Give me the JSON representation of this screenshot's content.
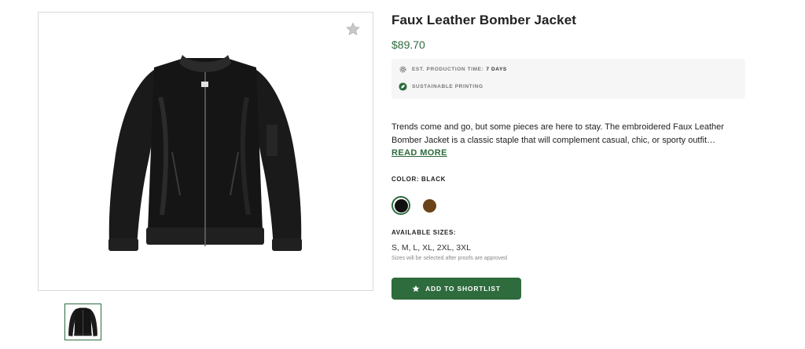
{
  "product": {
    "title": "Faux Leather Bomber Jacket",
    "price": "$89.70",
    "description": "Trends come and go, but some pieces are here to stay. The embroidered Faux Leather Bomber Jacket is a classic staple that will complement casual, chic, or sporty outfit…",
    "read_more_label": "READ MORE"
  },
  "info": {
    "production_label": "EST. PRODUCTION TIME:",
    "production_value": "7 DAYS",
    "sustainable_label": "SUSTAINABLE PRINTING"
  },
  "color": {
    "label": "COLOR: BLACK",
    "options": [
      {
        "name": "Black",
        "hex": "#111111",
        "selected": true
      },
      {
        "name": "Brown",
        "hex": "#6b4318",
        "selected": false
      }
    ]
  },
  "sizes": {
    "label": "AVAILABLE SIZES:",
    "value": "S, M, L, XL, 2XL, 3XL",
    "note": "Sizes will be selected after proofs are approved"
  },
  "actions": {
    "shortlist_label": "ADD TO SHORTLIST"
  },
  "icons": {
    "favorite": "star-icon",
    "production": "gear-icon",
    "sustainable": "leaf-icon",
    "shortlist": "star-icon"
  },
  "colors": {
    "accent": "#2e6b3d",
    "info_bg": "#f6f6f6"
  }
}
